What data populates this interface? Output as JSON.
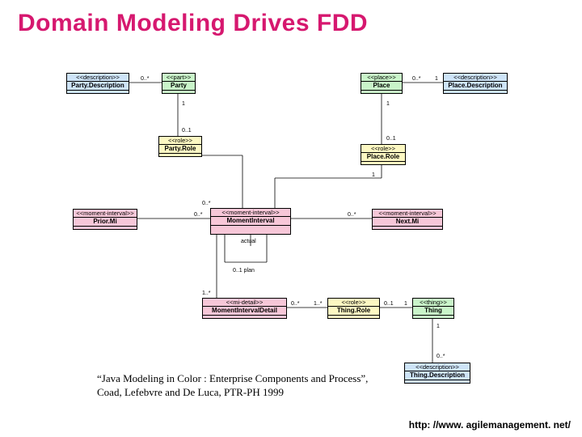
{
  "title": "Domain Modeling Drives FDD",
  "boxes": {
    "partyDescription": {
      "stereo": "<<description>>",
      "name": "Party.Description"
    },
    "party": {
      "stereo": "<<part>>",
      "name": "Party"
    },
    "place": {
      "stereo": "<<place>>",
      "name": "Place"
    },
    "placeDescription": {
      "stereo": "<<description>>",
      "name": "Place.Description"
    },
    "partyRole": {
      "stereo": "<<role>>",
      "name": "Party.Role"
    },
    "placeRole": {
      "stereo": "<<role>>",
      "name": "Place.Role"
    },
    "priorMi": {
      "stereo": "<<moment-interval>>",
      "name": "Prior.Mi"
    },
    "momentInterval": {
      "stereo": "<<moment-interval>>",
      "name": "MomentInterval"
    },
    "nextMi": {
      "stereo": "<<moment-interval>>",
      "name": "Next.Mi"
    },
    "momentIntervalDetail": {
      "stereo": "<<mi-detail>>",
      "name": "MomentIntervalDetail"
    },
    "thingRole": {
      "stereo": "<<role>>",
      "name": "Thing.Role"
    },
    "thing": {
      "stereo": "<<thing>>",
      "name": "Thing"
    },
    "thingDescription": {
      "stereo": "<<description>>",
      "name": "Thing.Description"
    }
  },
  "labels": {
    "m_0s": "0..*",
    "m_0s2": "0..*",
    "m_1": "1",
    "m_0_1": "0..1",
    "m_0_1b": "0..1",
    "m_0_1c": "0..1",
    "m_0_1_plan": "0..1  plan",
    "m_1s": "1..*",
    "m_1s2": "1..*",
    "m_0sA": "0..*",
    "m_0sB": "0..*",
    "m_0sC": "0..*",
    "m_0sD": "0..*",
    "m_1a": "1",
    "m_1b": "1",
    "m_1c": "1",
    "m_1d": "1",
    "actual": "actual"
  },
  "caption": {
    "line1": "“Java Modeling in Color : Enterprise Components and Process”,",
    "line2": "Coad, Lefebvre and De Luca, PTR-PH 1999"
  },
  "footer": "http: //www. agilemanagement. net/"
}
